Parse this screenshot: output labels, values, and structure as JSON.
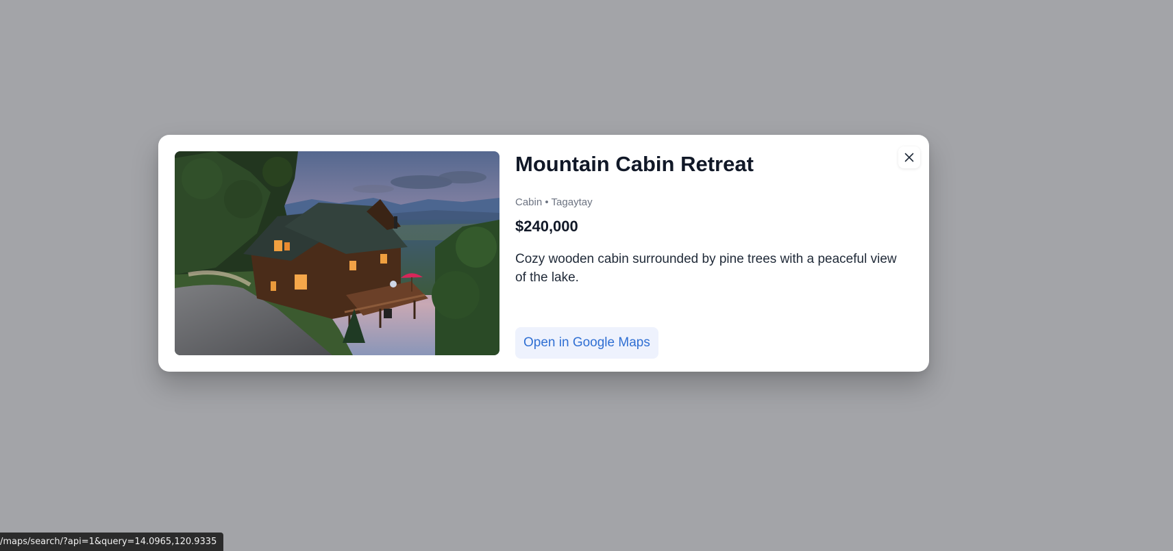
{
  "listing": {
    "title": "Mountain Cabin Retreat",
    "type": "Cabin",
    "separator": "•",
    "location": "Tagaytay",
    "price": "$240,000",
    "description": "Cozy wooden cabin surrounded by pine trees with a peaceful view of the lake.",
    "maps_button_label": "Open in Google Maps",
    "image": "cabin-at-dusk-photo"
  },
  "modal": {
    "close_icon": "close-icon"
  },
  "status_bar": {
    "url": "/maps/search/?api=1&query=14.0965,120.9335"
  },
  "colors": {
    "backdrop": "#a3a4a8",
    "title": "#111827",
    "muted": "#6b7280",
    "link": "#2f6fd3",
    "button_bg": "#eef2fd"
  }
}
